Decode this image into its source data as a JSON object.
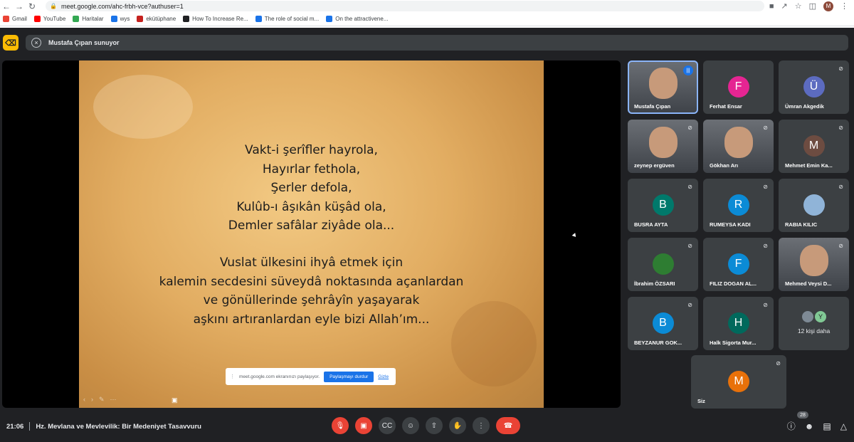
{
  "browser": {
    "url": "meet.google.com/ahc-frbh-vce?authuser=1",
    "profile_initial": "M",
    "bookmarks": [
      {
        "label": "Gmail",
        "color": "#ea4335"
      },
      {
        "label": "YouTube",
        "color": "#ff0000"
      },
      {
        "label": "Haritalar",
        "color": "#34a853"
      },
      {
        "label": "wys",
        "color": "#1a73e8"
      },
      {
        "label": "ekütüphane",
        "color": "#c5221f"
      },
      {
        "label": "How To Increase Re...",
        "color": "#202124"
      },
      {
        "label": "The role of social m...",
        "color": "#1a73e8"
      },
      {
        "label": "On the attractivene...",
        "color": "#1a73e8"
      }
    ]
  },
  "presenting": {
    "label": "Mustafa Çıpan sunuyor"
  },
  "slide": {
    "stanza1": [
      "Vakt-i şerîfler hayrola,",
      "Hayırlar fethola,",
      "Şerler defola,",
      "Kulûb-ı âşıkân küşâd ola,",
      "Demler safâlar ziyâde ola..."
    ],
    "stanza2": [
      "Vuslat ülkesini ihyâ etmek için",
      "kalemin secdesini süveydâ noktasında açanlardan",
      "ve gönüllerinde şehrâyîn yaşayarak",
      "aşkını artıranlardan eyle bizi Allah’ım..."
    ]
  },
  "share_notice": {
    "text": "meet.google.com ekranınızı paylaşıyor.",
    "stop_label": "Paylaşmayı durdur",
    "hide_label": "Gizle"
  },
  "participants": [
    {
      "name": "Mustafa Çıpan",
      "type": "photo",
      "speaking": true
    },
    {
      "name": "Ferhat Ensar",
      "type": "avatar",
      "initial": "F",
      "color": "#e52592"
    },
    {
      "name": "Ümran Akgedik",
      "type": "avatar",
      "initial": "Ü",
      "color": "#5c6bc0",
      "muted": true
    },
    {
      "name": "zeynep ergüven",
      "type": "photo",
      "muted": true
    },
    {
      "name": "Gökhan Arı",
      "type": "photo",
      "muted": true
    },
    {
      "name": "Mehmet Emin Ka...",
      "type": "avatar",
      "initial": "M",
      "color": "#6d4c41",
      "muted": true
    },
    {
      "name": "BUSRA AYTA",
      "type": "avatar",
      "initial": "B",
      "color": "#00796b",
      "muted": true
    },
    {
      "name": "RUMEYSA KADI",
      "type": "avatar",
      "initial": "R",
      "color": "#0b8bd6",
      "muted": true
    },
    {
      "name": "RABIA KILIC",
      "type": "avatar",
      "initial": "",
      "color": "#90b4d8",
      "muted": true
    },
    {
      "name": "İbrahim ÖZSARI",
      "type": "avatar",
      "initial": "",
      "color": "#2e7d32",
      "muted": true
    },
    {
      "name": "FILIZ DOGAN AL...",
      "type": "avatar",
      "initial": "F",
      "color": "#0b8bd6",
      "muted": true
    },
    {
      "name": "Mehmed Veysi D...",
      "type": "photo",
      "muted": true
    },
    {
      "name": "BEYZANUR GOK...",
      "type": "avatar",
      "initial": "B",
      "color": "#0b8bd6",
      "muted": true
    },
    {
      "name": "Halk Sigorta Mur...",
      "type": "avatar",
      "initial": "H",
      "color": "#00695c",
      "muted": true
    },
    {
      "name": "12 kişi daha",
      "type": "more",
      "extra_initial": "Y"
    },
    {
      "name": "Siz",
      "type": "avatar",
      "initial": "M",
      "color": "#e8710a",
      "muted": true
    }
  ],
  "bottom": {
    "time": "21:06",
    "meeting_title": "Hz. Mevlana ve Mevlevilik: Bir Medeniyet Tasavvuru",
    "participant_count": "28"
  },
  "icons": {
    "mic_off": "mic-off-icon",
    "cam_off": "camera-off-icon",
    "captions": "captions-icon",
    "emoji": "emoji-icon",
    "present": "present-icon",
    "hand": "raise-hand-icon",
    "more": "more-vert-icon",
    "end_call": "end-call-icon"
  }
}
